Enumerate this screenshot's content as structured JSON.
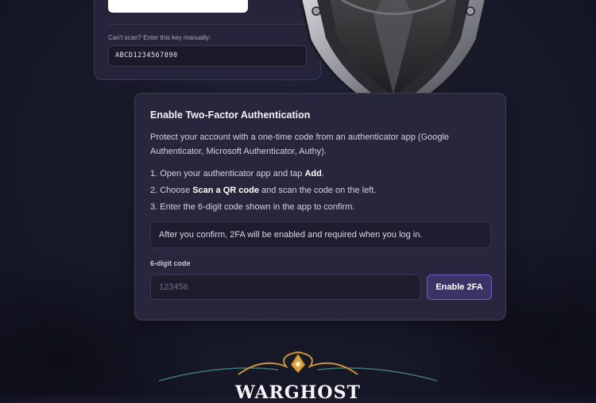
{
  "setup_card": {
    "manual_label": "Can't scan? Enter this key manually:",
    "manual_key": "ABCD1234567890"
  },
  "twofa_card": {
    "title": "Enable Two-Factor Authentication",
    "description": "Protect your account with a one-time code from an authenticator app (Google Authenticator, Microsoft Authenticator, Authy).",
    "steps": [
      {
        "prefix": "1. Open your authenticator app and tap ",
        "bold": "Add",
        "suffix": "."
      },
      {
        "prefix": "2. Choose ",
        "bold": "Scan a QR code",
        "suffix": " and scan the code on the left."
      },
      {
        "prefix": "3. Enter the 6-digit code shown in the app to confirm.",
        "bold": "",
        "suffix": ""
      }
    ],
    "note": "After you confirm, 2FA will be enabled and required when you log in.",
    "code_label": "6-digit code",
    "code_placeholder": "123456",
    "code_value": "",
    "button_label": "Enable 2FA"
  },
  "footer": {
    "logo_text": "WARGHOST"
  },
  "colors": {
    "background": "#181a2a",
    "card": "#27263d",
    "accent": "#6b5ec2",
    "gold": "#d9a441"
  }
}
